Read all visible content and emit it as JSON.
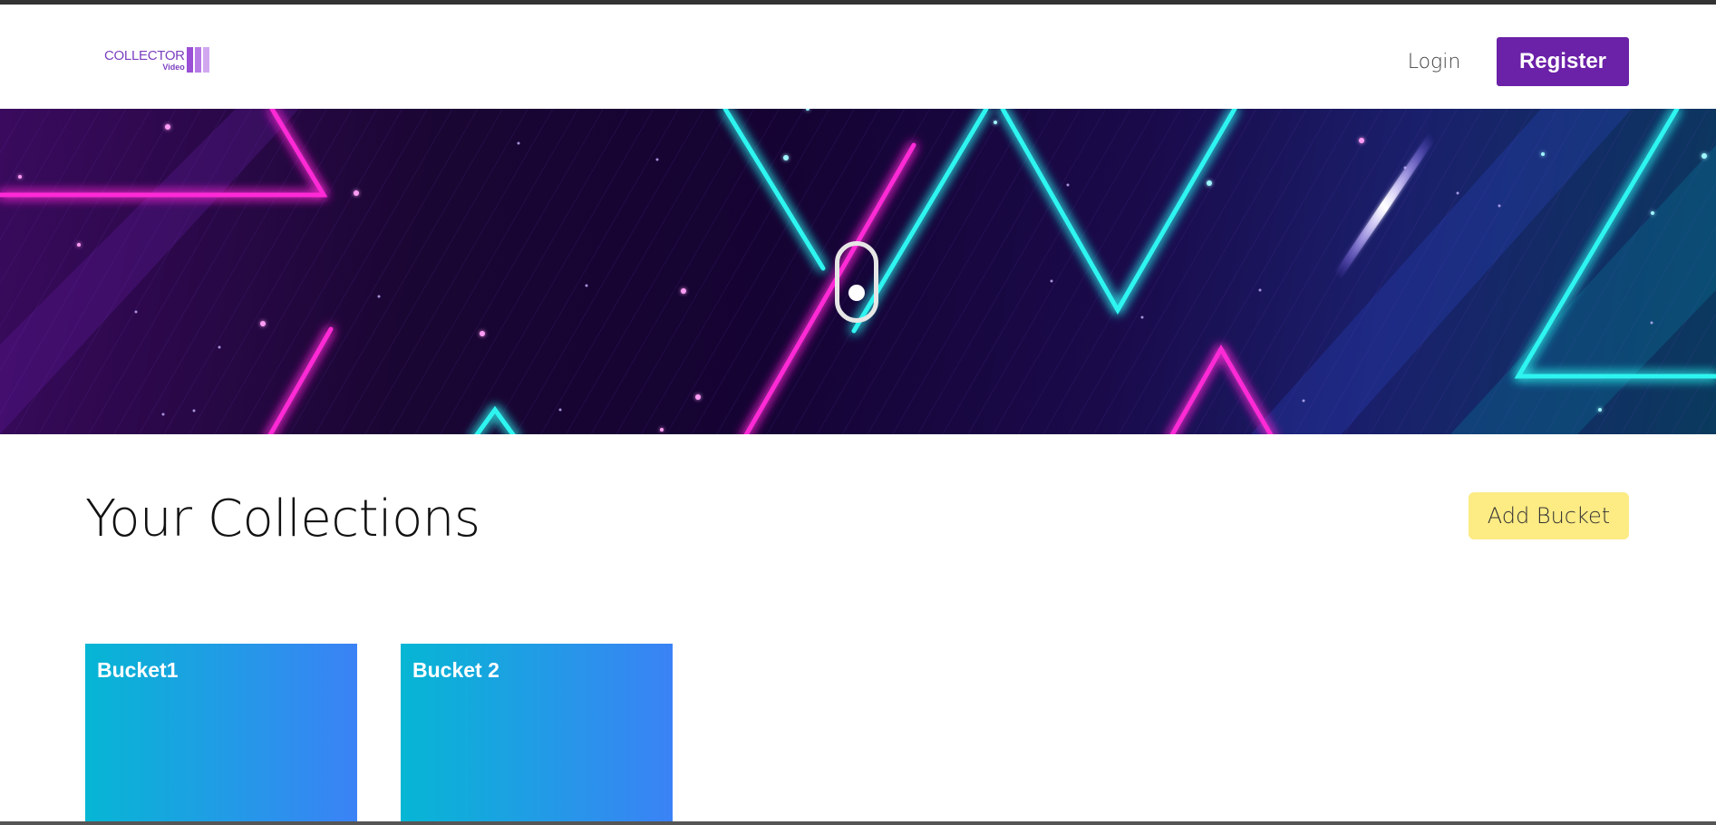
{
  "navbar": {
    "logo": {
      "main_text": "COLLECTOR",
      "sub_text": "Video"
    },
    "login_label": "Login",
    "register_label": "Register"
  },
  "hero": {
    "icon": "scroll-mouse-icon"
  },
  "collections": {
    "title": "Your Collections",
    "add_bucket_label": "Add Bucket",
    "buckets": [
      {
        "name": "Bucket1"
      },
      {
        "name": "Bucket 2"
      }
    ]
  },
  "colors": {
    "brand_purple": "#6b21a8",
    "add_button_yellow": "#fdeb84",
    "card_gradient_start": "#06b6d4",
    "card_gradient_end": "#3b82f6",
    "neon_magenta": "#ff2bd6",
    "neon_cyan": "#2ef5f0"
  }
}
